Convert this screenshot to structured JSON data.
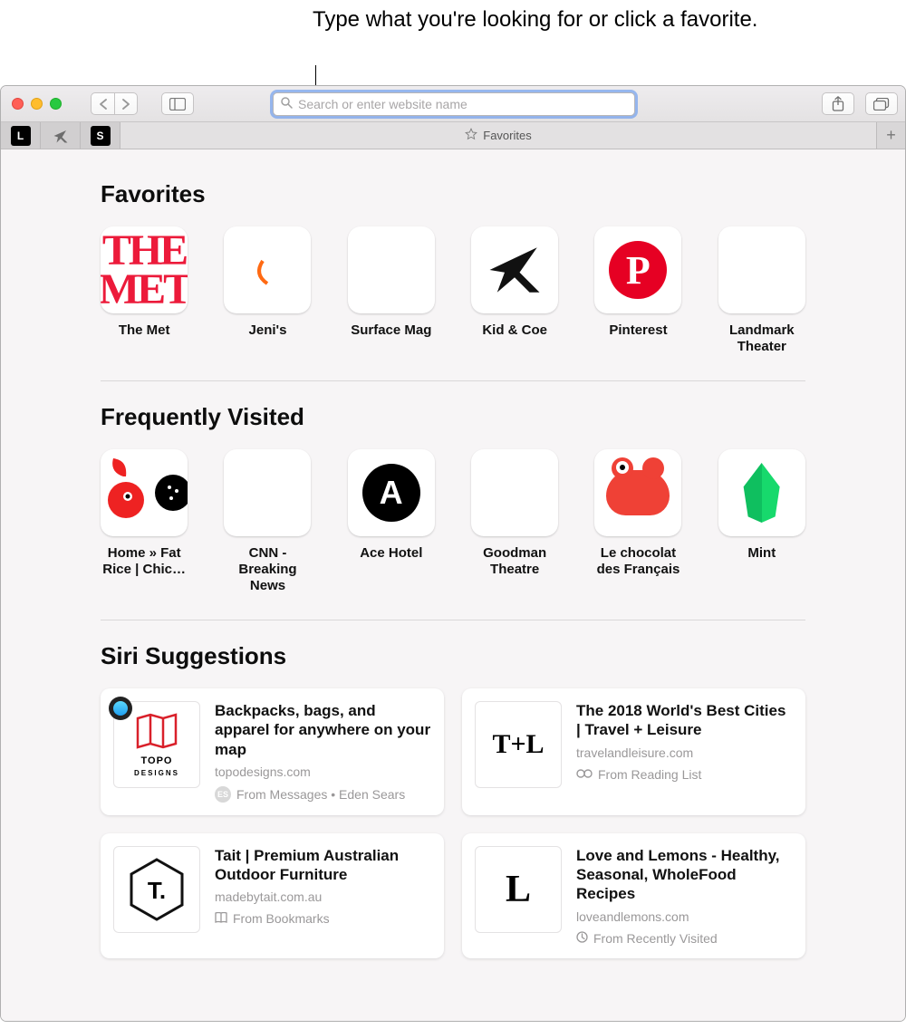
{
  "callout": "Type what you're looking for or click a favorite.",
  "toolbar": {
    "search_placeholder": "Search or enter website name"
  },
  "tab": {
    "active_label": "Favorites"
  },
  "sections": {
    "favorites_title": "Favorites",
    "frequent_title": "Frequently Visited",
    "siri_title": "Siri Suggestions"
  },
  "favorites": [
    {
      "label": "The Met"
    },
    {
      "label": "Jeni's"
    },
    {
      "label": "Surface Mag"
    },
    {
      "label": "Kid & Coe"
    },
    {
      "label": "Pinterest"
    },
    {
      "label": "Landmark Theater"
    }
  ],
  "frequent": [
    {
      "label": "Home » Fat Rice | Chic…"
    },
    {
      "label": "CNN - Breaking News"
    },
    {
      "label": "Ace Hotel"
    },
    {
      "label": "Goodman Theatre"
    },
    {
      "label": "Le chocolat des Français"
    },
    {
      "label": "Mint"
    }
  ],
  "siri": [
    {
      "title": "Backpacks, bags, and apparel for anywhere on your map",
      "domain": "topodesigns.com",
      "source": "From Messages • Eden Sears",
      "source_icon": "ES",
      "thumb": "TOPO"
    },
    {
      "title": "The 2018 World's Best Cities | Travel + Leisure",
      "domain": "travelandleisure.com",
      "source": "From Reading List",
      "source_icon": "glasses",
      "thumb": "T+L"
    },
    {
      "title": "Tait | Premium Australian Outdoor Furniture",
      "domain": "madebytait.com.au",
      "source": "From Bookmarks",
      "source_icon": "book",
      "thumb": "T."
    },
    {
      "title": "Love and Lemons - Healthy, Seasonal, WholeFood Recipes",
      "domain": "loveandlemons.com",
      "source": "From Recently Visited",
      "source_icon": "clock",
      "thumb": "L"
    }
  ]
}
